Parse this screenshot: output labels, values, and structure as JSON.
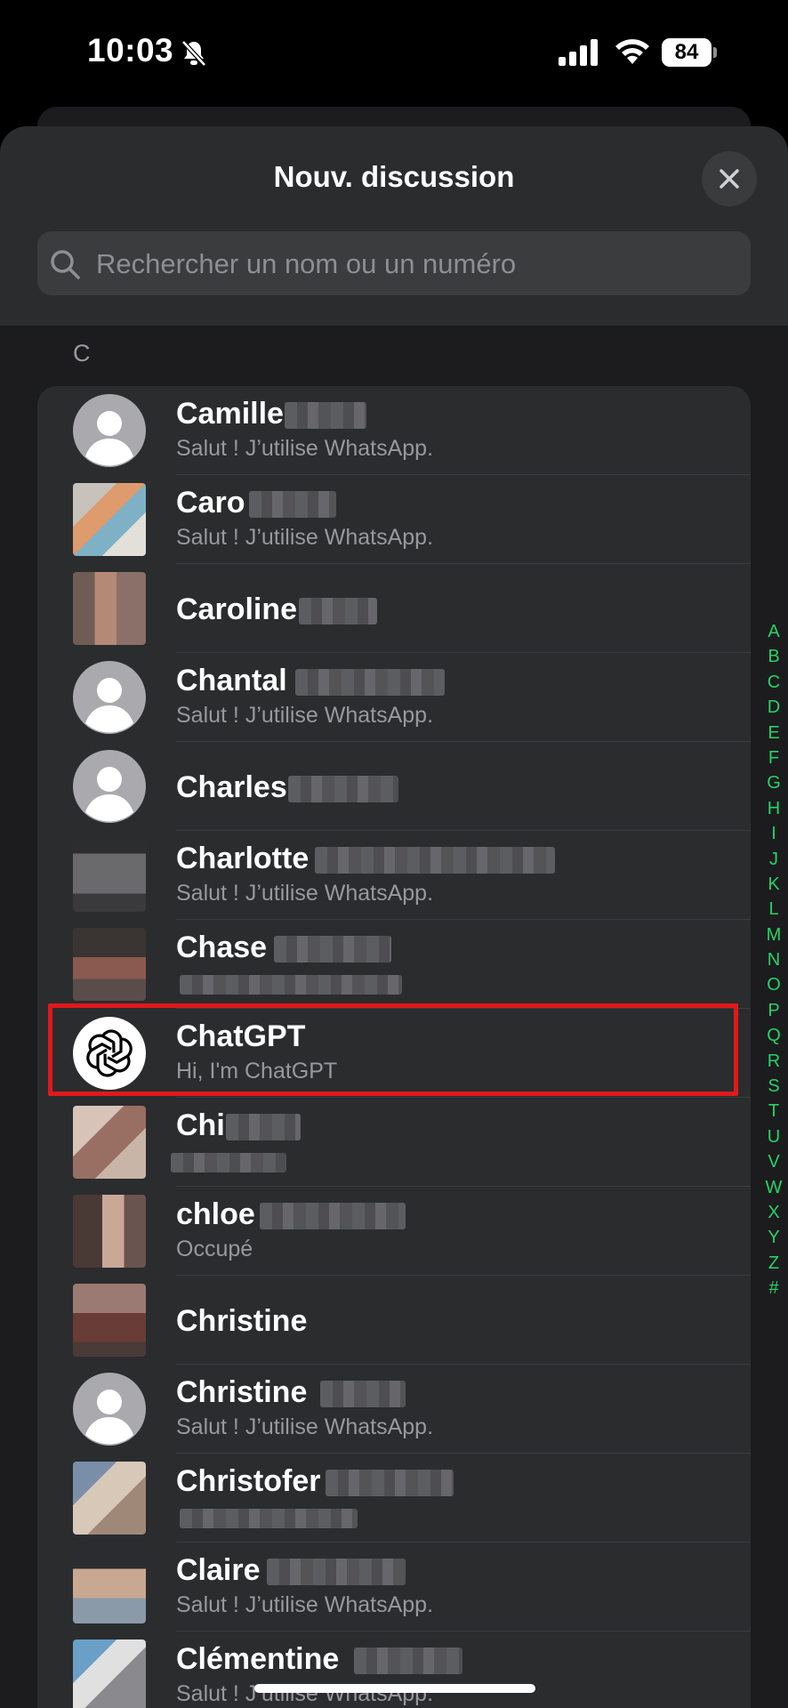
{
  "status_bar": {
    "time": "10:03",
    "battery": "84"
  },
  "header": {
    "title": "Nouv. discussion"
  },
  "search": {
    "placeholder": "Rechercher un nom ou un numéro"
  },
  "section": {
    "letter": "C"
  },
  "contacts": [
    {
      "name": "Camille",
      "status": "Salut ! J’utilise WhatsApp.",
      "avatar": "default"
    },
    {
      "name": "Caro",
      "status": "Salut ! J’utilise WhatsApp.",
      "avatar": "photo"
    },
    {
      "name": "Caroline",
      "status": "",
      "avatar": "photo"
    },
    {
      "name": "Chantal",
      "status": "Salut ! J’utilise WhatsApp.",
      "avatar": "default"
    },
    {
      "name": "Charles",
      "status": "",
      "avatar": "default"
    },
    {
      "name": "Charlotte",
      "status": "Salut ! J’utilise WhatsApp.",
      "avatar": "photo"
    },
    {
      "name": "Chase",
      "status": "",
      "avatar": "photo"
    },
    {
      "name": "ChatGPT",
      "status": "Hi, I'm ChatGPT",
      "avatar": "chatgpt-logo",
      "highlighted": true
    },
    {
      "name": "Chi",
      "status": "",
      "avatar": "photo"
    },
    {
      "name": "chloe",
      "status": "Occupé",
      "avatar": "photo"
    },
    {
      "name": "Christine",
      "status": "",
      "avatar": "photo"
    },
    {
      "name": "Christine",
      "status": "Salut ! J’utilise WhatsApp.",
      "avatar": "default"
    },
    {
      "name": "Christofer",
      "status": "",
      "avatar": "photo"
    },
    {
      "name": "Claire",
      "status": "Salut ! J’utilise WhatsApp.",
      "avatar": "photo"
    },
    {
      "name": "Clémentine",
      "status": "Salut ! J’utilise WhatsApp.",
      "avatar": "photo"
    }
  ],
  "alphabet_index": [
    "A",
    "B",
    "C",
    "D",
    "E",
    "F",
    "G",
    "H",
    "I",
    "J",
    "K",
    "L",
    "M",
    "N",
    "O",
    "P",
    "Q",
    "R",
    "S",
    "T",
    "U",
    "V",
    "W",
    "X",
    "Y",
    "Z",
    "#"
  ],
  "colors": {
    "accent": "#25D366",
    "highlight_border": "#E0191B",
    "background": "#1C1C1E"
  }
}
